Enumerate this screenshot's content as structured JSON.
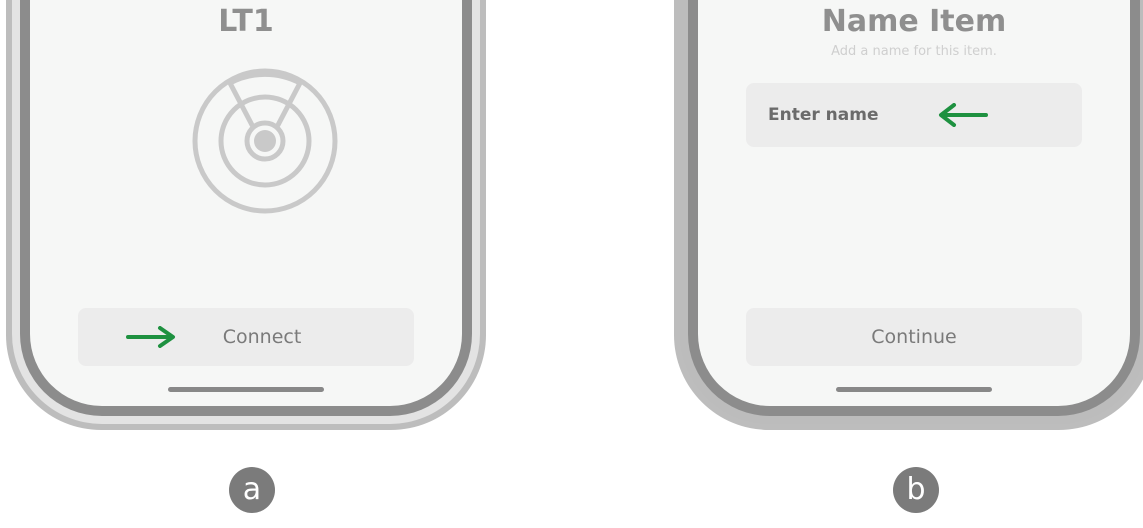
{
  "screen_a": {
    "title": "LT1",
    "connect_button_label": "Connect",
    "badge": "a"
  },
  "screen_b": {
    "title": "Name Item",
    "subtitle": "Add a name for this item.",
    "name_input_placeholder": "Enter name",
    "continue_button_label": "Continue",
    "badge": "b"
  },
  "icons": {
    "radar": "radar-icon",
    "connect_arrow": "arrow-right-icon",
    "input_arrow": "arrow-left-icon"
  },
  "colors": {
    "screen_bg": "#f6f7f6",
    "button_bg": "#ececec",
    "arrow_green": "#1e9140",
    "badge_bg": "#7b7b7b"
  }
}
